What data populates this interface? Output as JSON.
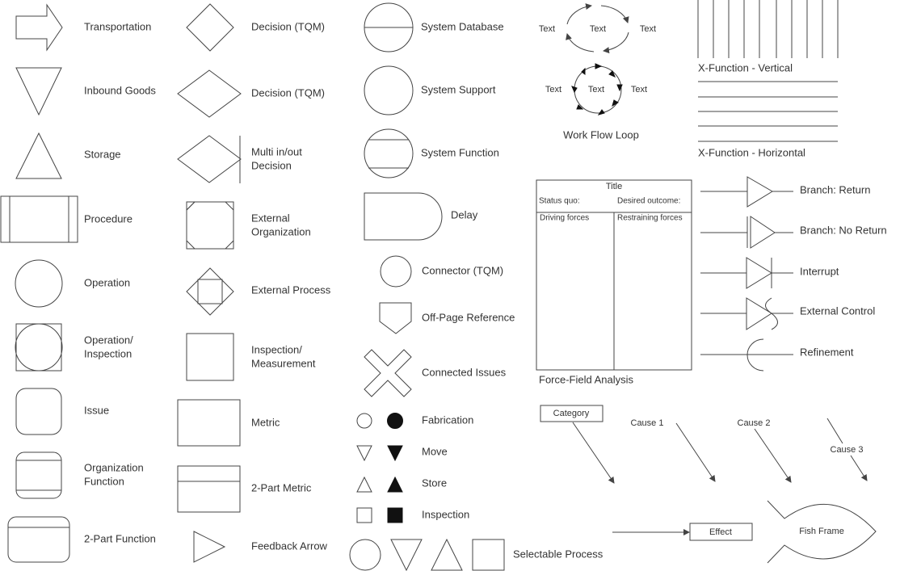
{
  "labels": {
    "transportation": "Transportation",
    "inbound_goods": "Inbound Goods",
    "storage": "Storage",
    "procedure": "Procedure",
    "operation": "Operation",
    "operation_inspection": [
      "Operation/",
      "Inspection"
    ],
    "issue": "Issue",
    "organization_function": [
      "Organization",
      "Function"
    ],
    "two_part_function": "2-Part Function",
    "decision_1": "Decision (TQM)",
    "decision_2": "Decision (TQM)",
    "multi_decision": [
      "Multi in/out",
      "Decision"
    ],
    "external_organization": [
      "External",
      "Organization"
    ],
    "external_process": "External Process",
    "inspection_measurement": [
      "Inspection/",
      "Measurement"
    ],
    "metric": "Metric",
    "two_part_metric": "2-Part Metric",
    "feedback_arrow": "Feedback Arrow",
    "system_database": "System Database",
    "system_support": "System Support",
    "system_function": "System Function",
    "delay": "Delay",
    "connector": "Connector (TQM)",
    "off_page_reference": "Off-Page Reference",
    "connected_issues": "Connected Issues",
    "fabrication": "Fabrication",
    "move": "Move",
    "store": "Store",
    "inspection": "Inspection",
    "selectable_process": "Selectable Process",
    "work_flow_loop": "Work Flow Loop",
    "x_function_vertical": "X-Function - Vertical",
    "x_function_horizontal": "X-Function - Horizontal",
    "force_field_analysis": "Force-Field Analysis",
    "branch_return": "Branch: Return",
    "branch_no_return": "Branch: No Return",
    "interrupt": "Interrupt",
    "external_control": "External Control",
    "refinement": "Refinement",
    "fish_frame": "Fish Frame"
  },
  "work_flow_loop": {
    "ellipse_texts": [
      "Text",
      "Text",
      "Text"
    ],
    "circle_texts": [
      "Text",
      "Text",
      "Text"
    ]
  },
  "force_field": {
    "title": "Title",
    "status_quo": "Status quo:",
    "desired_outcome": "Desired outcome:",
    "driving_forces": "Driving forces",
    "restraining_forces": "Restraining forces"
  },
  "fishbone": {
    "category": "Category",
    "cause_1": "Cause 1",
    "cause_2": "Cause 2",
    "cause_3": "Cause 3",
    "effect": "Effect"
  },
  "colors": {
    "stroke": "#444444",
    "text": "#333333",
    "fill": "#111111"
  }
}
